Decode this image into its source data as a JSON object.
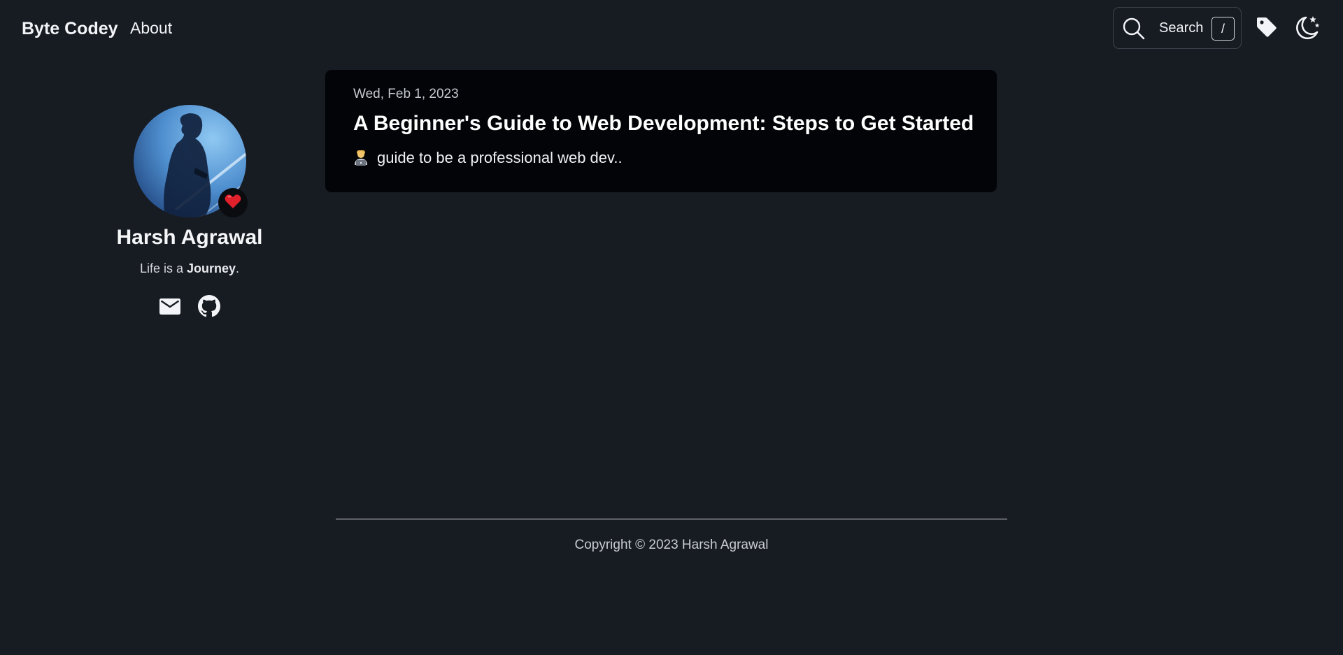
{
  "header": {
    "brand": "Byte Codey",
    "nav": {
      "about": "About"
    },
    "search": {
      "label": "Search",
      "shortcut": "/"
    },
    "icons": {
      "search": "search-icon",
      "tags": "tag-icon",
      "theme": "moon-stars-icon"
    }
  },
  "profile": {
    "name": "Harsh Agrawal",
    "bio_prefix": "Life is a ",
    "bio_emphasis": "Journey",
    "bio_suffix": ".",
    "status_icon": "heart-icon",
    "social_icons": [
      "mail-icon",
      "github-icon"
    ]
  },
  "posts": [
    {
      "date": "Wed, Feb 1, 2023",
      "title": "A Beginner's Guide to Web Development: Steps to Get Started",
      "description": "guide to be a professional web dev..",
      "emoji": "technologist-emoji"
    }
  ],
  "footer": {
    "copyright": "Copyright © 2023 Harsh Agrawal"
  },
  "colors": {
    "background": "#171b22",
    "card": "#020407",
    "accent_heart": "#e0202b"
  }
}
